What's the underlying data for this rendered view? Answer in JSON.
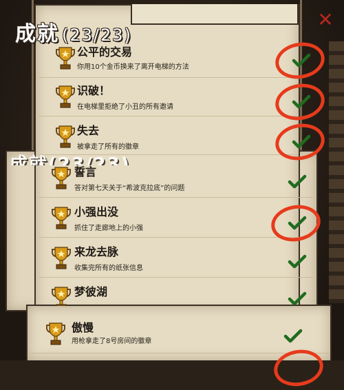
{
  "header": {
    "title": "成就",
    "count": "(23/23)",
    "ghost_title": "成就(23/23)",
    "close_symbol": "✕"
  },
  "achievements": [
    {
      "title": "公平的交易",
      "desc": "你用10个金币换来了离开电梯的方法",
      "completed": true,
      "circled": true
    },
    {
      "title": "识破！",
      "desc": "在电梯里拒绝了小丑的所有邀请",
      "completed": true,
      "circled": true
    },
    {
      "title": "失去",
      "desc": "被拿走了所有的徽章",
      "completed": true,
      "circled": true
    },
    {
      "title": "誓言",
      "desc": "答对第七天关于“希波克拉底”的问题",
      "completed": true,
      "circled": false
    },
    {
      "title": "小强出没",
      "desc": "抓住了走廊地上的小强",
      "completed": true,
      "circled": true
    },
    {
      "title": "来龙去脉",
      "desc": "收集完所有的纸张信息",
      "completed": true,
      "circled": false
    },
    {
      "title": "梦彼湖",
      "desc": "",
      "completed": true,
      "circled": false
    },
    {
      "title": "傲慢",
      "desc": "用枪拿走了8号房间的徽章",
      "completed": true,
      "circled": false
    }
  ],
  "colors": {
    "paper": "#e6dcc3",
    "check": "#1f6b1f",
    "annotation_circle": "#e63b1c",
    "close": "#b3271e",
    "trophy": "#d99a1a"
  }
}
